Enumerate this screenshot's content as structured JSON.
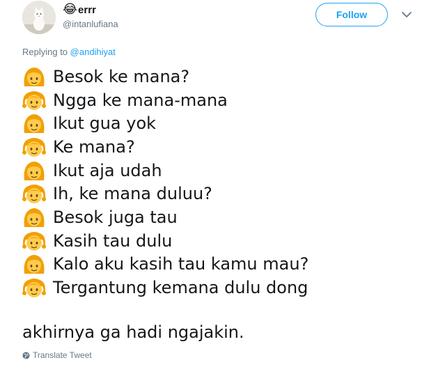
{
  "header": {
    "name_emoji": "😂",
    "name": "errr",
    "handle": "@intanlufiana",
    "follow_label": "Follow"
  },
  "replying": {
    "prefix": "Replying to ",
    "to": "@andihiyat"
  },
  "lines": [
    {
      "speaker": "woman",
      "text": "Besok ke mana?"
    },
    {
      "speaker": "girl",
      "text": "Ngga ke mana-mana"
    },
    {
      "speaker": "woman",
      "text": "Ikut gua yok"
    },
    {
      "speaker": "girl",
      "text": "Ke mana?"
    },
    {
      "speaker": "woman",
      "text": "Ikut aja udah"
    },
    {
      "speaker": "girl",
      "text": "Ih, ke mana duluu?"
    },
    {
      "speaker": "woman",
      "text": "Besok juga tau"
    },
    {
      "speaker": "girl",
      "text": "Kasih tau dulu"
    },
    {
      "speaker": "woman",
      "text": "Kalo aku kasih tau kamu mau?"
    },
    {
      "speaker": "girl",
      "text": "Tergantung kemana dulu dong"
    }
  ],
  "closing": "akhirnya ga hadi ngajakin.",
  "translate_label": "Translate Tweet",
  "colors": {
    "accent": "#1da1f2",
    "secondary_text": "#657786",
    "text": "#14171a",
    "emoji_hair": "#f29f05",
    "emoji_skin": "#ffcb4c"
  }
}
